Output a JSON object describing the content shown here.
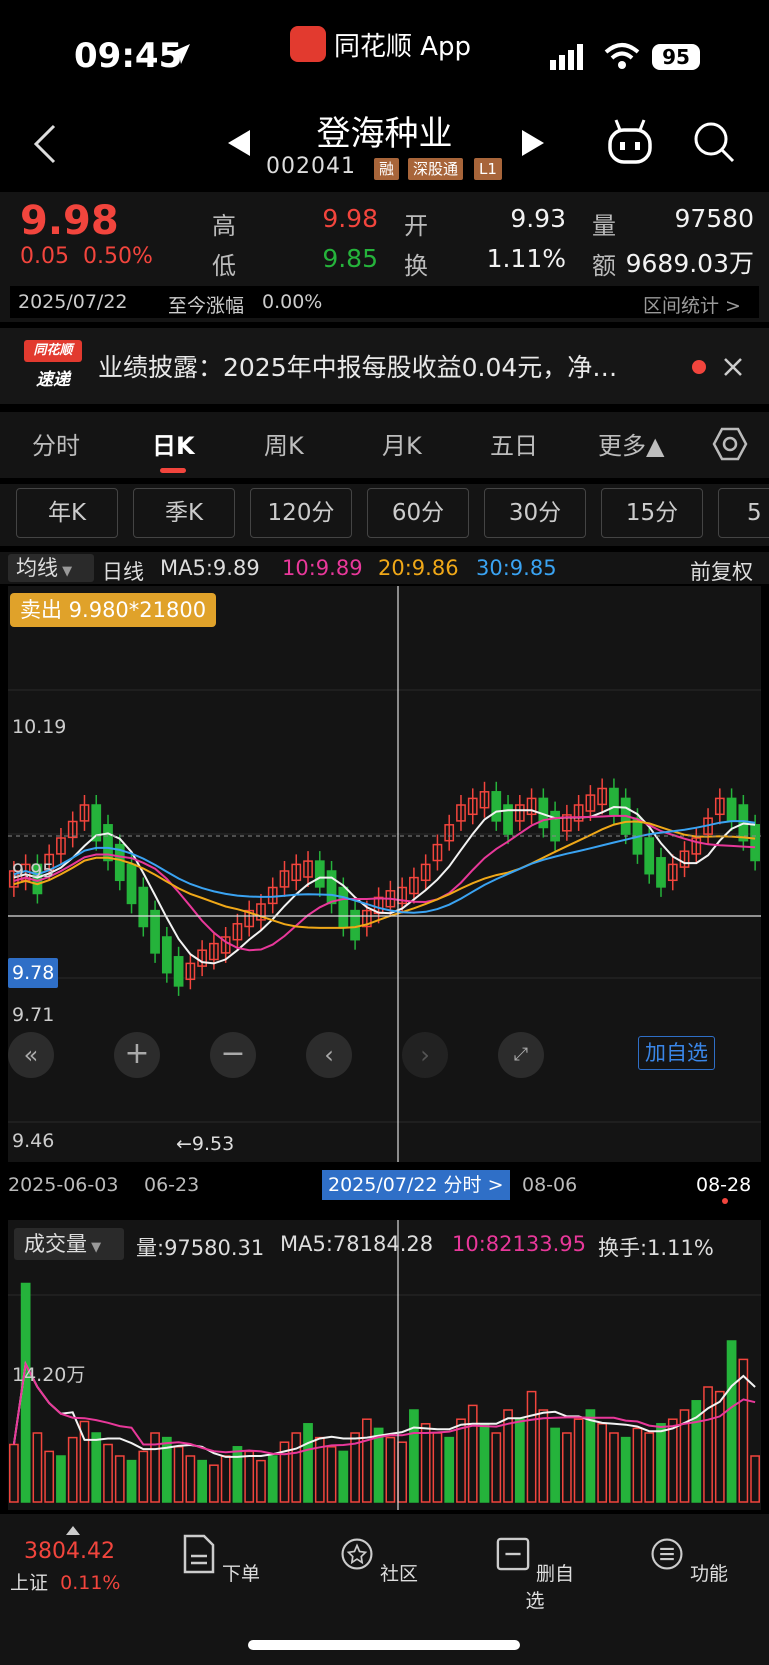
{
  "status": {
    "time": "09:45",
    "app": "同花顺 App",
    "battery": "95"
  },
  "header": {
    "stock_name": "登海种业",
    "stock_code": "002041",
    "tags": [
      "融",
      "深股通",
      "L1"
    ]
  },
  "quote": {
    "price": "9.98",
    "change": "0.05",
    "change_pct": "0.50%",
    "high_label": "高",
    "high": "9.98",
    "low_label": "低",
    "low": "9.85",
    "open_label": "开",
    "open": "9.93",
    "turnover_label": "换",
    "turnover": "1.11%",
    "volume_label": "量",
    "volume": "97580",
    "amount_label": "额",
    "amount": "9689.03万",
    "date": "2025/07/22",
    "since_label": "至今涨幅",
    "since_value": "0.00%",
    "range_stats": "区间统计 >"
  },
  "news": {
    "logo_top": "同花顺",
    "logo_bottom": "速递",
    "text": "业绩披露：2025年中报每股收益0.04元，净…"
  },
  "tabs": [
    "分时",
    "日K",
    "周K",
    "月K",
    "五日",
    "更多▲"
  ],
  "active_tab": "日K",
  "chips": [
    "年K",
    "季K",
    "120分",
    "60分",
    "30分",
    "15分",
    "5"
  ],
  "ma_bar": {
    "selector": "均线",
    "period": "日线",
    "ma5": "MA5:9.89",
    "ma10": "10:9.89",
    "ma20": "20:9.86",
    "ma30": "30:9.85",
    "adjust": "前复权"
  },
  "chart": {
    "trade_tooltip": "卖出 9.980*21800",
    "y_labels": [
      "10.19",
      "9.95",
      "9.71",
      "9.46"
    ],
    "crosshair_price": "9.78",
    "low_marker": "←9.53",
    "add_watch": "加自选",
    "colors": {
      "up": "#f2453d",
      "down": "#25b33b",
      "ma5": "#f2f2f2",
      "ma10": "#e8389a",
      "ma20": "#f0a818",
      "ma30": "#3aa3f2"
    }
  },
  "xaxis": {
    "start": "2025-06-03",
    "mid": "06-23",
    "cursor": "2025/07/22 分时 >",
    "right_mid": "08-06",
    "end": "08-28"
  },
  "volume": {
    "selector": "成交量",
    "vol": "量:97580.31",
    "ma5": "MA5:78184.28",
    "ma10": "10:82133.95",
    "turnover": "换手:1.11%",
    "y_label": "14.20万"
  },
  "bottom": {
    "index_value": "3804.42",
    "index_name": "上证",
    "index_pct": "0.11%",
    "items": [
      "下单",
      "社区",
      "删自选",
      "功能"
    ]
  }
}
